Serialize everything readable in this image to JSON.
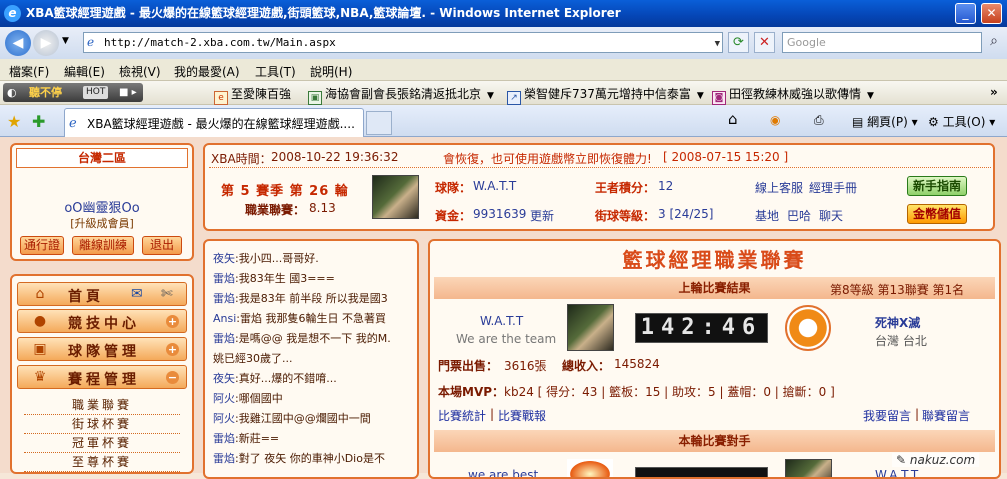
{
  "window": {
    "title": "XBA籃球經理遊戲 - 最火爆的在線籃球經理遊戲,街頭籃球,NBA,籃球論壇. - Windows Internet Explorer",
    "url": "http://match-2.xba.com.tw/Main.aspx",
    "search_placeholder": "Google"
  },
  "menubar": {
    "items": [
      "檔案(F)",
      "編輯(E)",
      "檢視(V)",
      "我的最愛(A)",
      "工具(T)",
      "說明(H)"
    ]
  },
  "favbar": {
    "radio_label": "聽不停",
    "radio_hot": "HOT",
    "items": [
      "至愛陳百強",
      "海協會副會長張銘清返抵北京",
      "榮智健斥737萬元增持中信泰富",
      "田徑教練林威強以歌傳情"
    ]
  },
  "tabbar": {
    "tab_title": "XBA籃球經理遊戲 - 最火爆的在線籃球經理遊戲....",
    "tools": [
      "網頁(P)",
      "工具(O)"
    ]
  },
  "sidebar": {
    "region": "台灣二區",
    "username": "oO幽靈狠Oo",
    "member_type": "[升級成會員]",
    "buttons": [
      "通行證",
      "離線訓練",
      "退出"
    ],
    "menu": [
      {
        "label": "首頁",
        "icon": "home-icon"
      },
      {
        "label": "競技中心",
        "icon": "basketball-icon"
      },
      {
        "label": "球隊管理",
        "icon": "clipboard-icon"
      },
      {
        "label": "賽程管理",
        "icon": "trophy-icon"
      }
    ],
    "submenu": [
      "職業聯賽",
      "街球杯賽",
      "冠軍杯賽",
      "至尊杯賽"
    ]
  },
  "info": {
    "time_label": "XBA時間：",
    "time_value": "2008-10-22 19:36:32",
    "notice": "會恢復，也可使用遊戲幣立即恢復體力!",
    "notice_date": "[ 2008-07-15 15:20 ]",
    "season": "第 5 賽季 第 26 輪",
    "league_label": "職業聯賽：",
    "league_value": "8.13",
    "team_label": "球隊：",
    "team_value": "W.A.T.T",
    "funds_label": "資金：",
    "funds_value": "9931639",
    "funds_link": "更新",
    "king_label": "王者積分：",
    "king_value": "12",
    "street_label": "街球等級：",
    "street_value": "3 [24/25]",
    "links_row1": [
      "線上客服",
      "經理手冊"
    ],
    "links_row2": [
      "基地",
      "巴哈",
      "聊天"
    ],
    "newbie_btn": "新手指南",
    "gold_btn": "金幣儲值"
  },
  "chat": {
    "lines": [
      {
        "who": "夜矢",
        "text": ":我小四...哥哥好."
      },
      {
        "who": "雷焰",
        "text": ":我83年生 國3==="
      },
      {
        "who": "雷焰",
        "text": ":我是83年 前半段 所以我是國3"
      },
      {
        "who": "Ansi",
        "text": ":雷焰 我那隻6輪生日 不急著買"
      },
      {
        "who": "雷焰",
        "text": ":是嗎@@ 我是想不一下 我的M."
      },
      {
        "who": "",
        "text": "姚已經30歲了..."
      },
      {
        "who": "夜矢",
        "text": ":真好...爆的不錯唷..."
      },
      {
        "who": "阿火",
        "text": ":哪個國中"
      },
      {
        "who": "阿火",
        "text": ":我雞江國中@@爛國中一間"
      },
      {
        "who": "雷焰",
        "text": ":新莊=="
      },
      {
        "who": "雷焰",
        "text": ":對了 夜矢 你的車神小Dio是不"
      }
    ]
  },
  "league": {
    "banner": "籃球經理職業聯賽",
    "last_match_header": "上輪比賽結果",
    "level_info": "第8等級 第13聯賽 第1名",
    "home_team": "W.A.T.T",
    "home_motto": "We are the team",
    "score": "142:46",
    "away_team": "死神X滅",
    "away_location": "台灣 台北",
    "tickets_label": "門票出售：",
    "tickets_value": "3616張",
    "income_label": "總收入：",
    "income_value": "145824",
    "mvp_label": "本場MVP：",
    "mvp_value": "kb24 [ 得分：43 | 籃板：15 | 助攻：5 | 蓋帽：0 | 搶斷：0 ]",
    "link_stats": "比賽統計",
    "link_report": "比賽戰報",
    "link_message": "我要留言",
    "link_board": "聯賽留言",
    "next_match_header": "本輪比賽對手",
    "next_home": "we are best",
    "next_away": "W.A.T.T"
  },
  "watermark": "nakuz.com"
}
